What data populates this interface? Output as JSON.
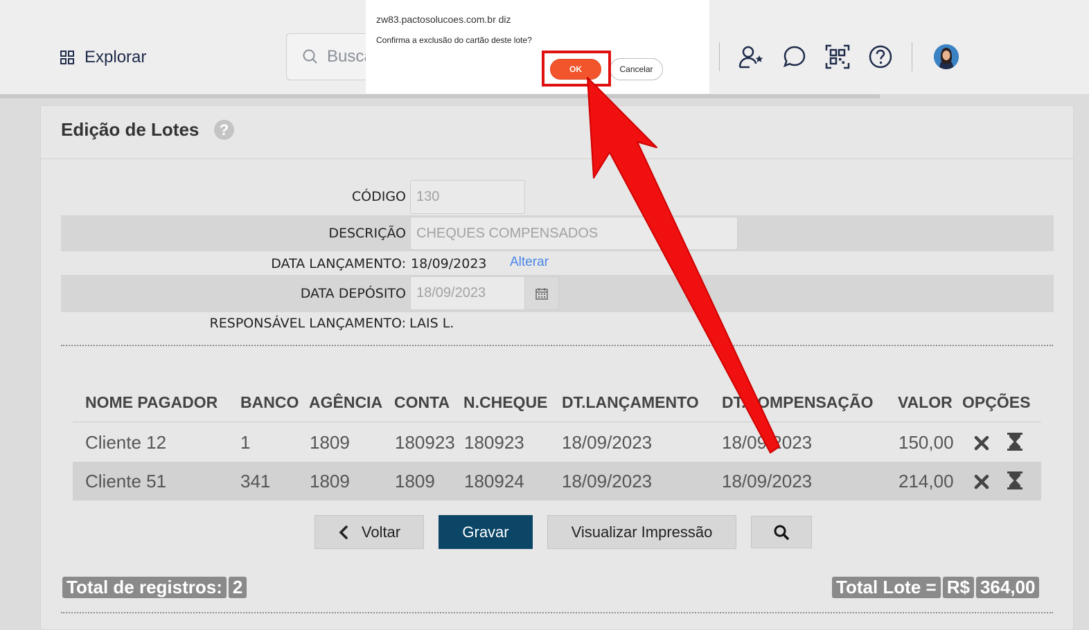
{
  "topbar": {
    "explore_label": "Explorar",
    "search_placeholder": "Busca",
    "icons": [
      "grid-icon",
      "search-icon",
      "user-star-icon",
      "chat-icon",
      "qr-scan-icon",
      "help-icon",
      "avatar"
    ]
  },
  "dialog": {
    "origin": "zw83.pactosolucoes.com.br diz",
    "message": "Confirma a exclusão do cartão deste lote?",
    "ok_label": "OK",
    "cancel_label": "Cancelar"
  },
  "panel": {
    "title": "Edição de Lotes",
    "help_glyph": "?",
    "form": {
      "codigo_label": "CÓDIGO",
      "codigo_value": "130",
      "descricao_label": "DESCRIÇÃO",
      "descricao_value": "CHEQUES COMPENSADOS",
      "data_lancamento_label": "DATA LANÇAMENTO:",
      "data_lancamento_value": "18/09/2023",
      "alterar_label": "Alterar",
      "data_deposito_label": "DATA DEPÓSITO",
      "data_deposito_value": "18/09/2023",
      "responsavel_label": "RESPONSÁVEL LANÇAMENTO:",
      "responsavel_value": "LAIS L."
    },
    "table": {
      "headers": [
        "NOME PAGADOR",
        "BANCO",
        "AGÊNCIA",
        "CONTA",
        "N.CHEQUE",
        "DT.LANÇAMENTO",
        "DT.COMPENSAÇÃO",
        "VALOR",
        "OPÇÕES"
      ],
      "rows": [
        [
          "Cliente 12",
          "1",
          "1809",
          "180923",
          "180923",
          "18/09/2023",
          "18/09/2023",
          "150,00"
        ],
        [
          "Cliente 51",
          "341",
          "1809",
          "1809",
          "180924",
          "18/09/2023",
          "18/09/2023",
          "214,00"
        ]
      ]
    },
    "buttons": {
      "voltar": "Voltar",
      "gravar": "Gravar",
      "visualizar": "Visualizar Impressão"
    },
    "totals": {
      "registros_label": "Total de registros:",
      "registros_value": "2",
      "lote_label": "Total Lote =",
      "lote_currency": "R$",
      "lote_value": "364,00"
    }
  },
  "colors": {
    "ok_button": "#f2552c",
    "highlight": "#e01010",
    "primary_button": "#0b4667",
    "link": "#4a86e8"
  }
}
